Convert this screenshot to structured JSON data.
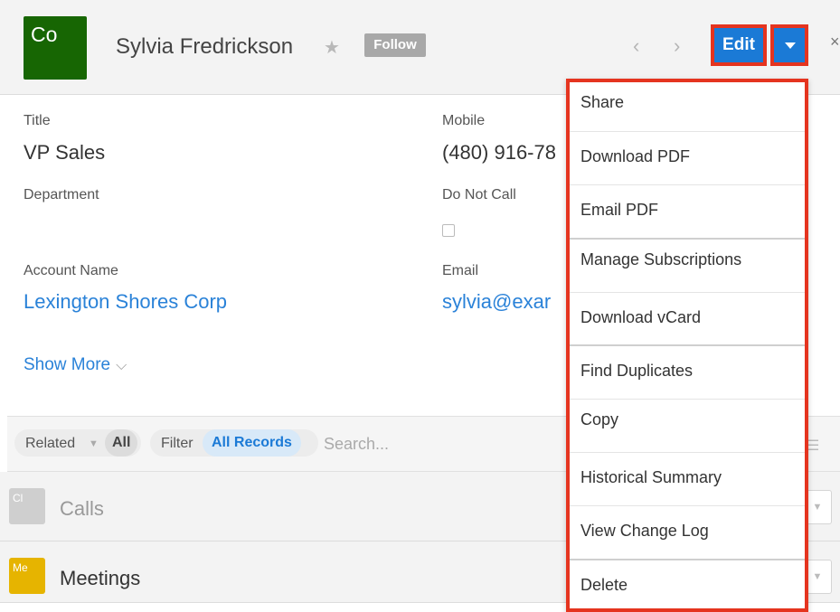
{
  "header": {
    "avatar_text": "Co",
    "avatar_color": "#176603",
    "record_name": "Sylvia Fredrickson",
    "favorite_icon": "star-icon",
    "follow_label": "Follow",
    "prev_icon": "chevron-left-icon",
    "next_icon": "chevron-right-icon",
    "edit_label": "Edit",
    "actions_icon": "caret-down-icon",
    "accent_color": "#1b7ad6",
    "highlight_color": "#e5341f"
  },
  "fields": {
    "title_label": "Title",
    "title_value": "VP Sales",
    "mobile_label": "Mobile",
    "mobile_value": "(480) 916-78",
    "department_label": "Department",
    "dnc_label": "Do Not Call",
    "account_label": "Account Name",
    "account_value": "Lexington Shores Corp",
    "email_label": "Email",
    "email_value": "sylvia@exar"
  },
  "show_more": "Show More",
  "filter_bar": {
    "related_label": "Related",
    "related_value": "All",
    "filter_label": "Filter",
    "filter_value": "All Records",
    "search_placeholder": "Search..."
  },
  "subpanels": [
    {
      "icon_text": "Cl",
      "name": "Calls",
      "color": "#cfcfcf"
    },
    {
      "icon_text": "Me",
      "name": "Meetings",
      "color": "#e6b400"
    }
  ],
  "actions_menu": [
    "Share",
    "Download PDF",
    "Email PDF",
    "Manage Subscriptions",
    "Download vCard",
    "Find Duplicates",
    "Copy",
    "Historical Summary",
    "View Change Log",
    "Delete"
  ]
}
